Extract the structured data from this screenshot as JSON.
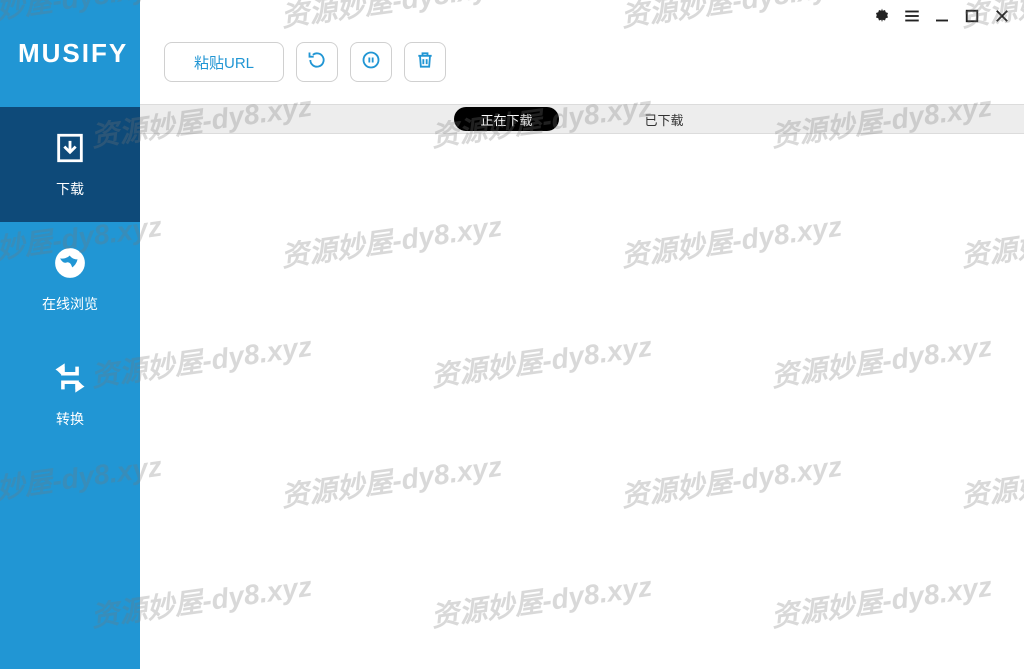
{
  "app": {
    "name": "MUSIFY"
  },
  "sidebar": {
    "items": [
      {
        "label": "下载",
        "icon": "download-icon",
        "active": true
      },
      {
        "label": "在线浏览",
        "icon": "globe-icon",
        "active": false
      },
      {
        "label": "转换",
        "icon": "convert-icon",
        "active": false
      }
    ]
  },
  "toolbar": {
    "paste_label": "粘贴URL"
  },
  "tabs": {
    "items": [
      {
        "label": "正在下载",
        "active": true
      },
      {
        "label": "已下载",
        "active": false
      }
    ]
  },
  "watermark": {
    "text": "资源妙屋-dy8.xyz"
  }
}
